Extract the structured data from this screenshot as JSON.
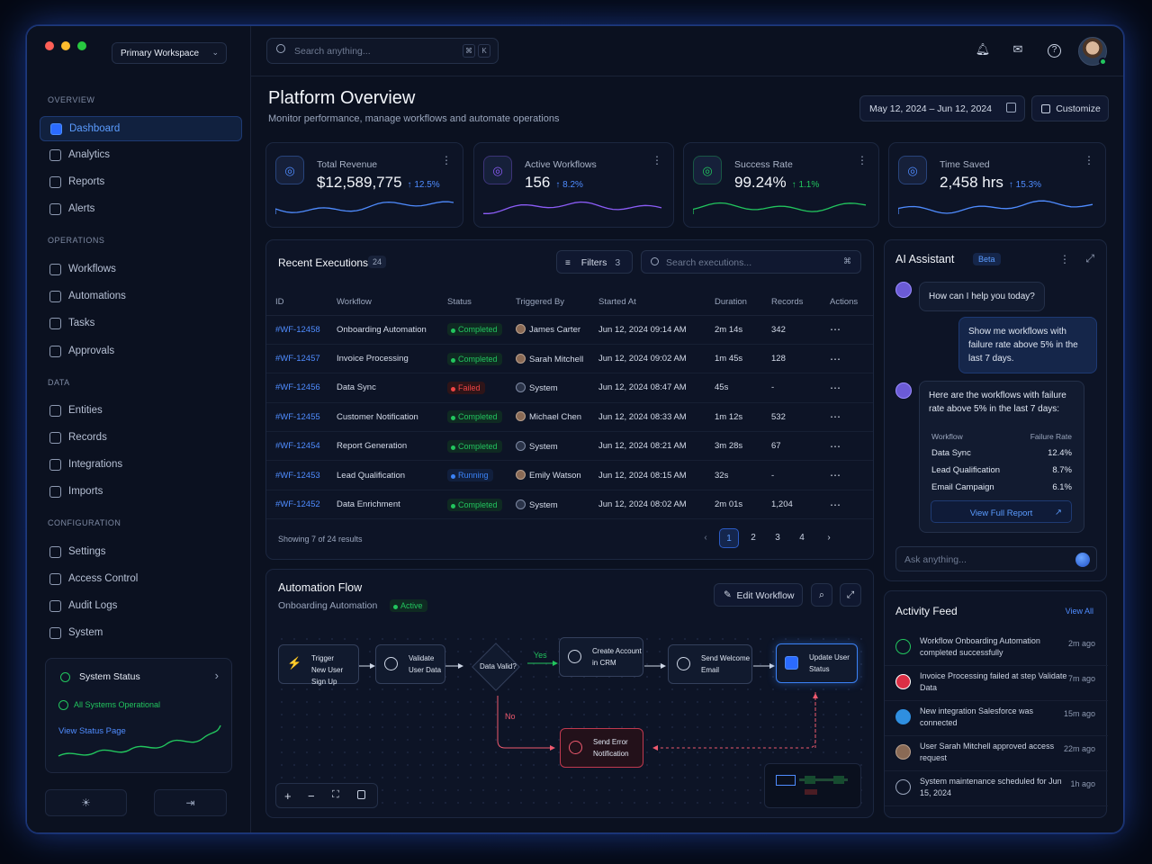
{
  "workspace": "Primary Workspace",
  "search": {
    "placeholder": "Search anything...",
    "kbd1": "⌘",
    "kbd2": "K"
  },
  "sidebar": {
    "sections": [
      {
        "title": "OVERVIEW",
        "items": [
          "Dashboard",
          "Analytics",
          "Reports",
          "Alerts"
        ]
      },
      {
        "title": "OPERATIONS",
        "items": [
          "Workflows",
          "Automations",
          "Tasks",
          "Approvals"
        ]
      },
      {
        "title": "DATA",
        "items": [
          "Entities",
          "Records",
          "Integrations",
          "Imports"
        ]
      },
      {
        "title": "CONFIGURATION",
        "items": [
          "Settings",
          "Access Control",
          "Audit Logs",
          "System"
        ]
      }
    ],
    "active": "Dashboard",
    "status": {
      "title": "System Status",
      "ok": "All Systems Operational",
      "link": "View Status Page"
    }
  },
  "page": {
    "title": "Platform Overview",
    "subtitle": "Monitor performance, manage workflows and automate operations",
    "date_range": "May 12, 2024 – Jun 12, 2024",
    "customize": "Customize"
  },
  "kpis": [
    {
      "label": "Total Revenue",
      "value": "$12,589,775",
      "change": "↑ 12.5%",
      "color": "#4f8cff"
    },
    {
      "label": "Active Workflows",
      "value": "156",
      "change": "↑ 8.2%",
      "color": "#8b5cf6"
    },
    {
      "label": "Success Rate",
      "value": "99.24%",
      "change": "↑ 1.1%",
      "color": "#22c55e"
    },
    {
      "label": "Time Saved",
      "value": "2,458 hrs",
      "change": "↑ 15.3%",
      "color": "#4f8cff"
    }
  ],
  "executions": {
    "title": "Recent Executions",
    "count": "24",
    "filters": "Filters",
    "filter_count": "3",
    "search_placeholder": "Search executions...",
    "columns": [
      "ID",
      "Workflow",
      "Status",
      "Triggered By",
      "Started At",
      "Duration",
      "Records",
      "Actions"
    ],
    "rows": [
      [
        "#WF-12458",
        "Onboarding Automation",
        "Completed",
        "James Carter",
        "Jun 12, 2024 09:14 AM",
        "2m 14s",
        "342"
      ],
      [
        "#WF-12457",
        "Invoice Processing",
        "Completed",
        "Sarah Mitchell",
        "Jun 12, 2024 09:02 AM",
        "1m 45s",
        "128"
      ],
      [
        "#WF-12456",
        "Data Sync",
        "Failed",
        "System",
        "Jun 12, 2024 08:47 AM",
        "45s",
        "-"
      ],
      [
        "#WF-12455",
        "Customer Notification",
        "Completed",
        "Michael Chen",
        "Jun 12, 2024 08:33 AM",
        "1m 12s",
        "532"
      ],
      [
        "#WF-12454",
        "Report Generation",
        "Completed",
        "System",
        "Jun 12, 2024 08:21 AM",
        "3m 28s",
        "67"
      ],
      [
        "#WF-12453",
        "Lead Qualification",
        "Running",
        "Emily Watson",
        "Jun 12, 2024 08:15 AM",
        "32s",
        "-"
      ],
      [
        "#WF-12452",
        "Data Enrichment",
        "Completed",
        "System",
        "Jun 12, 2024 08:02 AM",
        "2m 01s",
        "1,204"
      ]
    ],
    "showing": "Showing 7 of 24 results",
    "pages": [
      "1",
      "2",
      "3",
      "4"
    ]
  },
  "flow": {
    "title": "Automation Flow",
    "subtitle": "Onboarding Automation",
    "badge": "Active",
    "edit": "Edit Workflow",
    "nodes": [
      {
        "l1": "Trigger",
        "l2": "New User Sign Up"
      },
      {
        "l1": "Validate",
        "l2": "User Data"
      },
      {
        "l1": "Data Valid?",
        "l2": ""
      },
      {
        "l1": "Create Account",
        "l2": "in CRM"
      },
      {
        "l1": "Send Welcome",
        "l2": "Email"
      },
      {
        "l1": "Update User",
        "l2": "Status"
      },
      {
        "l1": "Send Error",
        "l2": "Notification"
      }
    ],
    "yes": "Yes",
    "no": "No"
  },
  "assistant": {
    "title": "AI Assistant",
    "badge": "Beta",
    "greeting": "How can I help you today?",
    "user_msg": "Show me workflows with failure rate above 5% in the last 7 days.",
    "reply": "Here are the workflows with failure rate above 5% in the last 7 days:",
    "table_head": [
      "Workflow",
      "Failure Rate"
    ],
    "table": [
      [
        "Data Sync",
        "12.4%"
      ],
      [
        "Lead Qualification",
        "8.7%"
      ],
      [
        "Email Campaign",
        "6.1%"
      ]
    ],
    "report_btn": "View Full Report",
    "input_placeholder": "Ask anything..."
  },
  "activity": {
    "title": "Activity Feed",
    "view_all": "View All",
    "items": [
      {
        "text": "Workflow Onboarding Automation completed successfully",
        "ago": "2m ago"
      },
      {
        "text": "Invoice Processing failed at step Validate Data",
        "ago": "7m ago"
      },
      {
        "text": "New integration Salesforce was connected",
        "ago": "15m ago"
      },
      {
        "text": "User Sarah Mitchell approved access request",
        "ago": "22m ago"
      },
      {
        "text": "System maintenance scheduled for Jun 15, 2024",
        "ago": "1h ago"
      }
    ]
  }
}
